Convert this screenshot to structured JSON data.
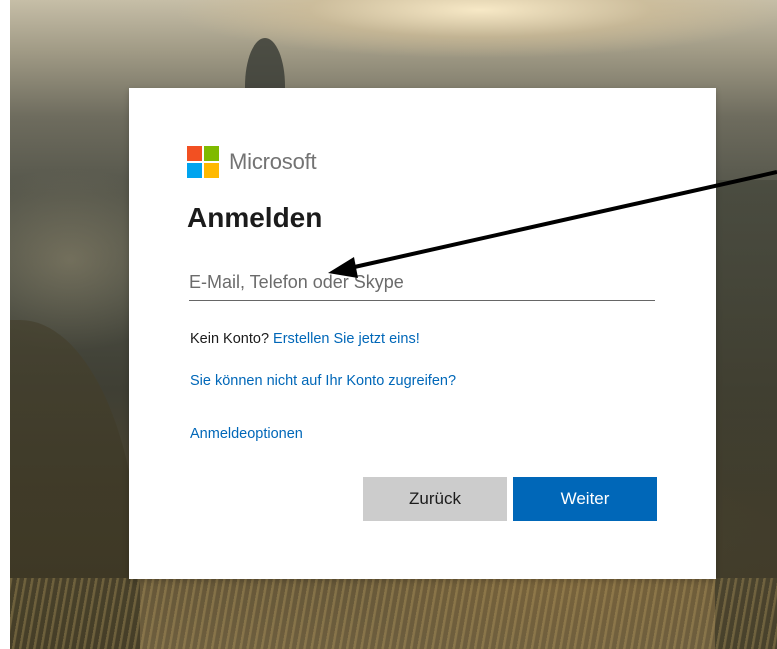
{
  "brand": {
    "name": "Microsoft",
    "logo_colors": [
      "#f25022",
      "#7fba00",
      "#00a4ef",
      "#ffb900"
    ]
  },
  "heading": "Anmelden",
  "email_input": {
    "value": "",
    "placeholder": "E-Mail, Telefon oder Skype"
  },
  "no_account": {
    "text": "Kein Konto? ",
    "link": "Erstellen Sie jetzt eins!"
  },
  "cant_access_link": "Sie können nicht auf Ihr Konto zugreifen?",
  "signin_options_link": "Anmeldeoptionen",
  "buttons": {
    "back": "Zurück",
    "next": "Weiter"
  },
  "colors": {
    "accent": "#0067b8",
    "back_button": "#cccccc",
    "annotation_arrow": "#000000"
  }
}
